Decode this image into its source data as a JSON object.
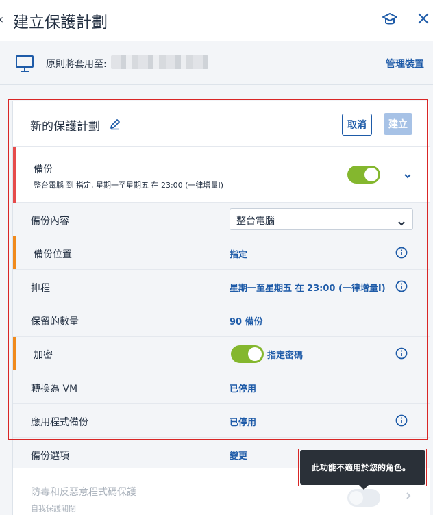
{
  "header": {
    "title": "建立保護計劃",
    "back_icon": "chevron-left-icon",
    "help_icon": "graduation-cap-icon",
    "close_icon": "close-icon"
  },
  "apply": {
    "label": "原則將套用至:",
    "manage": "管理裝置",
    "icon": "monitor-icon"
  },
  "plan": {
    "name": "新的保護計劃",
    "cancel": "取消",
    "create": "建立"
  },
  "backup": {
    "title": "備份",
    "subtitle": "整台電腦 到 指定, 星期一至星期五 在 23:00 (一律增量I)",
    "enabled": true
  },
  "rows": {
    "content": {
      "label": "備份內容",
      "value": "整台電腦"
    },
    "location": {
      "label": "備份位置",
      "value": "指定"
    },
    "schedule": {
      "label": "排程",
      "value": "星期一至星期五 在 23:00 (一律增量I)"
    },
    "retention": {
      "label": "保留的數量",
      "value": "90 備份"
    },
    "encryption": {
      "label": "加密",
      "value": "指定密碼",
      "enabled": true
    },
    "vm": {
      "label": "轉換為 VM",
      "value": "已停用"
    },
    "app": {
      "label": "應用程式備份",
      "value": "已停用"
    },
    "options": {
      "label": "備份選項",
      "value": "變更"
    }
  },
  "antivirus": {
    "title": "防毒和反惡意程式碼保護",
    "subtitle": "自我保護關閉"
  },
  "tooltip": {
    "text": "此功能不適用於您的角色。"
  },
  "colors": {
    "accent": "#1e5ba8",
    "toggle_on": "#84b72e",
    "error_stripe": "#e64b4b",
    "warning_stripe": "#f08a1c"
  }
}
